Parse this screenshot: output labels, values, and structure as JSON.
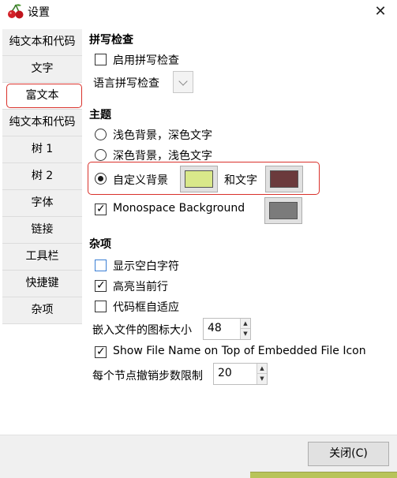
{
  "window": {
    "title": "设置",
    "close_glyph": "✕",
    "app_icon": "cherry-icon"
  },
  "sidebar": {
    "items": [
      {
        "label": "纯文本和代码"
      },
      {
        "label": "文字"
      },
      {
        "label": "富文本",
        "active": true
      },
      {
        "label": "纯文本和代码"
      },
      {
        "label": "树 1"
      },
      {
        "label": "树 2"
      },
      {
        "label": "字体"
      },
      {
        "label": "链接"
      },
      {
        "label": "工具栏"
      },
      {
        "label": "快捷键"
      },
      {
        "label": "杂项"
      }
    ]
  },
  "spell": {
    "header": "拼写检查",
    "enable_label": "启用拼写检查",
    "enable_checked": false,
    "language_label": "语言拼写检查",
    "language_value": ""
  },
  "theme": {
    "header": "主题",
    "options": [
      {
        "label": "浅色背景，深色文字",
        "selected": false
      },
      {
        "label": "深色背景，浅色文字",
        "selected": false
      },
      {
        "label": "自定义背景",
        "selected": true
      }
    ],
    "and_text_label": "和文字",
    "bg_color": "#d9e88a",
    "text_color": "#6b3a3c",
    "monospace_label": "Monospace Background",
    "monospace_checked": true,
    "monospace_color": "#7b7b7b"
  },
  "misc": {
    "header": "杂项",
    "show_whitespace_label": "显示空白字符",
    "show_whitespace_checked": false,
    "highlight_line_label": "高亮当前行",
    "highlight_line_checked": true,
    "codebox_autofit_label": "代码框自适应",
    "codebox_autofit_checked": false,
    "embedded_icon_size_label": "嵌入文件的图标大小",
    "embedded_icon_size_value": "48",
    "show_filename_label": "Show File Name on Top of Embedded File Icon",
    "show_filename_checked": true,
    "undo_limit_label": "每个节点撤销步数限制",
    "undo_limit_value": "20"
  },
  "footer": {
    "close_label": "关闭(C)"
  },
  "colors": {
    "highlight_outline": "#d9312b"
  }
}
